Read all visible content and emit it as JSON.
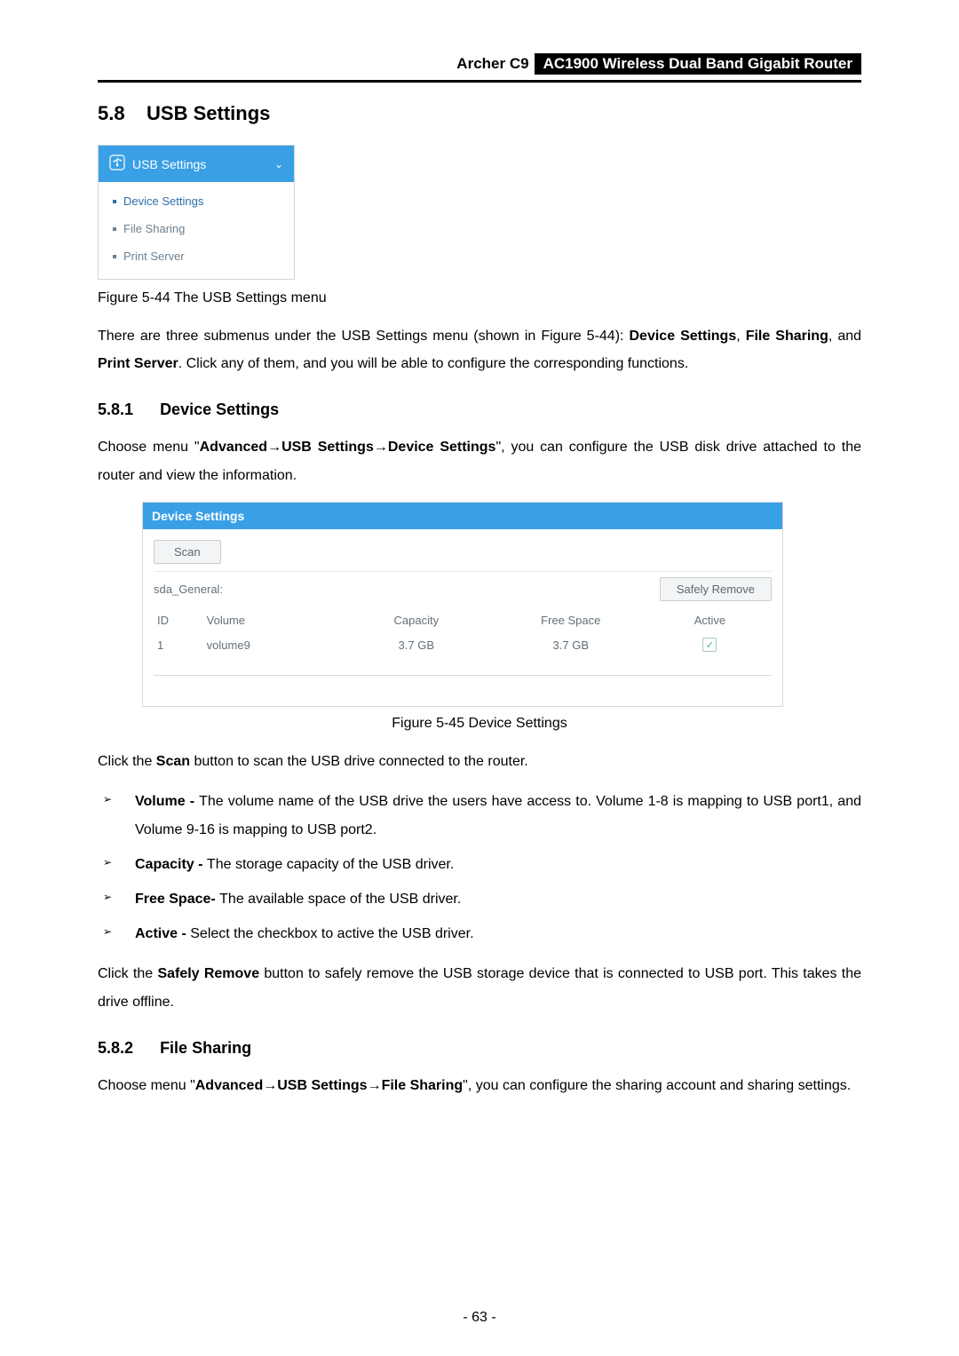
{
  "header": {
    "model": "Archer C9",
    "product": "AC1900 Wireless Dual Band Gigabit Router"
  },
  "section": {
    "number": "5.8",
    "title": "USB Settings"
  },
  "menuFigure": {
    "header": "USB Settings",
    "items": [
      "Device Settings",
      "File Sharing",
      "Print Server"
    ]
  },
  "figure44Caption": "Figure 5-44 The USB Settings menu",
  "intro": {
    "p1a": "There are three submenus under the USB Settings menu (shown in Figure 5-44): ",
    "p1b": "Device Settings",
    "p1c": ", ",
    "p1d": "File Sharing",
    "p1e": ", and ",
    "p1f": "Print Server",
    "p1g": ". Click any of them, and you will be able to configure the corresponding functions."
  },
  "sub1": {
    "number": "5.8.1",
    "title": "Device Settings",
    "p_a": "Choose menu \"",
    "p_b": "Advanced",
    "p_c": "USB Settings",
    "p_d": "Device Settings",
    "p_e": "\", you can configure the USB disk drive attached to the router and view the information."
  },
  "panel": {
    "title": "Device Settings",
    "scan": "Scan",
    "device": "sda_General:",
    "safelyRemove": "Safely Remove",
    "columns": {
      "id": "ID",
      "volume": "Volume",
      "capacity": "Capacity",
      "free": "Free Space",
      "active": "Active"
    },
    "rows": [
      {
        "id": "1",
        "volume": "volume9",
        "capacity": "3.7 GB",
        "free": "3.7 GB",
        "activeChecked": true
      }
    ]
  },
  "figure45Caption": "Figure 5-45 Device Settings",
  "scanLine": {
    "a": "Click the ",
    "b": "Scan",
    "c": " button to scan the USB drive connected to the router."
  },
  "bullets": {
    "volume": {
      "label": "Volume - ",
      "text": "The volume name of the USB drive the users have access to. Volume 1-8 is mapping to USB port1, and Volume 9-16 is mapping to USB port2."
    },
    "capacity": {
      "label": "Capacity - ",
      "text": "The storage capacity of the USB driver."
    },
    "freeSpace": {
      "label": "Free Space- ",
      "text": "The available space of the USB driver."
    },
    "active": {
      "label": "Active - ",
      "text": "Select the checkbox to active the USB driver."
    }
  },
  "safelyRemoveLine": {
    "a": "Click the ",
    "b": "Safely Remove",
    "c": " button to safely remove the USB storage device that is connected to USB port. This takes the drive offline."
  },
  "sub2": {
    "number": "5.8.2",
    "title": "File Sharing",
    "p_a": "Choose menu \"",
    "p_b": "Advanced",
    "p_c": "USB Settings",
    "p_d": "File Sharing",
    "p_e": "\", you can configure the sharing account and sharing settings."
  },
  "pageNumber": "- 63 -",
  "arrow": "→"
}
